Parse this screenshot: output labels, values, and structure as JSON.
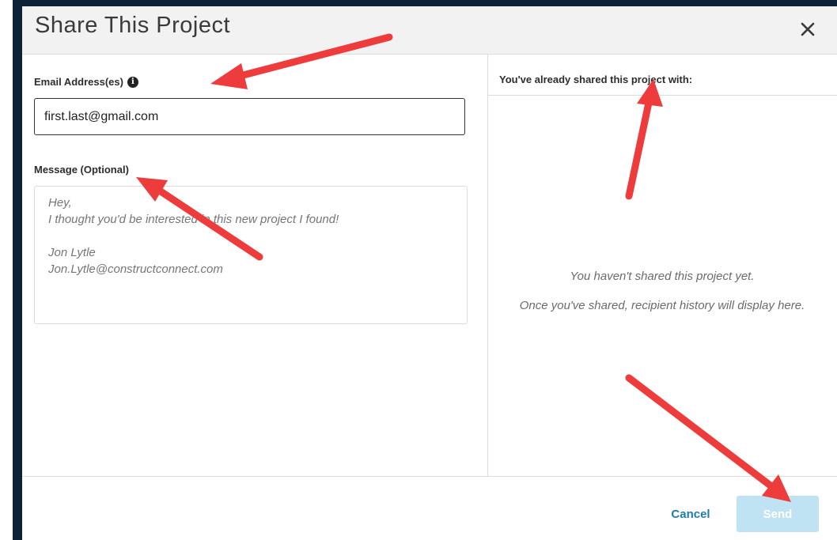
{
  "dialog": {
    "title": "Share This Project",
    "close_icon": "close-icon"
  },
  "form": {
    "email_label": "Email Address(es)",
    "email_info_icon": "info-icon",
    "email_value": "first.last@gmail.com",
    "message_label": "Message (Optional)",
    "message_placeholder": "Hey,\nI thought you'd be interested in this new project I found!\n\nJon Lytle\nJon.Lytle@constructconnect.com"
  },
  "shared": {
    "title": "You've already shared this project with:",
    "empty_line1": "You haven't shared this project yet.",
    "empty_line2": "Once you've shared, recipient history will display here."
  },
  "footer": {
    "cancel_label": "Cancel",
    "send_label": "Send"
  },
  "colors": {
    "frame_border": "#0d2236",
    "link_blue": "#1f7ea8",
    "send_disabled": "#bfe3f3",
    "annotation_arrow": "#ee3b3b"
  }
}
